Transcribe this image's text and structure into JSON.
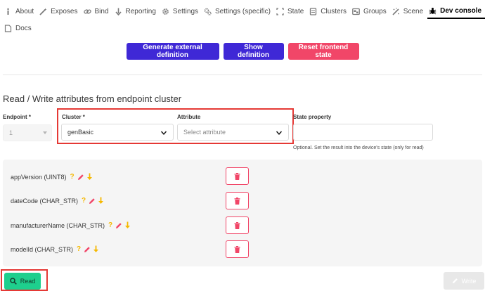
{
  "tabs": [
    {
      "label": "About",
      "icon": "info-icon"
    },
    {
      "label": "Exposes",
      "icon": "wand-icon"
    },
    {
      "label": "Bind",
      "icon": "link-icon"
    },
    {
      "label": "Reporting",
      "icon": "arrow-down-icon"
    },
    {
      "label": "Settings",
      "icon": "gear-icon"
    },
    {
      "label": "Settings (specific)",
      "icon": "gears-icon"
    },
    {
      "label": "State",
      "icon": "state-icon"
    },
    {
      "label": "Clusters",
      "icon": "clusters-icon"
    },
    {
      "label": "Groups",
      "icon": "groups-icon"
    },
    {
      "label": "Scene",
      "icon": "scene-icon"
    },
    {
      "label": "Dev console",
      "icon": "bug-icon",
      "active": true
    },
    {
      "label": "Docs",
      "icon": "docs-icon"
    }
  ],
  "actions": {
    "generate": "Generate external definition",
    "show": "Show definition",
    "reset": "Reset frontend state"
  },
  "section": {
    "title": "Read / Write attributes from endpoint cluster"
  },
  "form": {
    "endpoint_label": "Endpoint *",
    "endpoint_value": "1",
    "cluster_label": "Cluster *",
    "cluster_value": "genBasic",
    "attribute_label": "Attribute",
    "attribute_placeholder": "Select attribute",
    "state_label": "State property",
    "state_help": "Optional. Set the result into the device's state (only for read)"
  },
  "attributes": [
    {
      "name": "appVersion (UINT8)"
    },
    {
      "name": "dateCode (CHAR_STR)"
    },
    {
      "name": "manufacturerName (CHAR_STR)"
    },
    {
      "name": "modelId (CHAR_STR)"
    }
  ],
  "buttons": {
    "read": "Read",
    "write": "Write"
  },
  "colors": {
    "primary": "#3f28d6",
    "danger": "#f14668",
    "read": "#1ecf8d",
    "help_q": "#f5b800",
    "pen": "#f14668",
    "arrow": "#f5b800"
  }
}
